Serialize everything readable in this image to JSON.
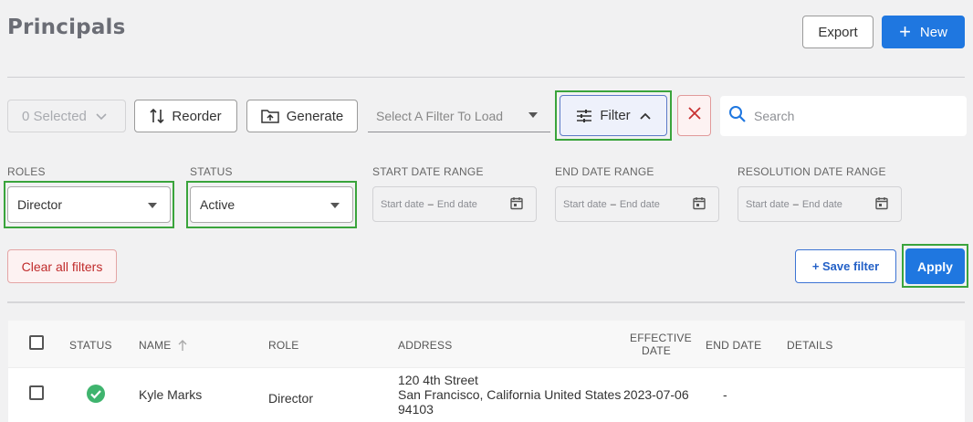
{
  "page": {
    "title": "Principals"
  },
  "header": {
    "export_label": "Export",
    "new_label": "New"
  },
  "toolbar": {
    "selected_label": "0 Selected",
    "reorder_label": "Reorder",
    "generate_label": "Generate",
    "filter_load_placeholder": "Select A Filter To Load",
    "filter_label": "Filter",
    "search_placeholder": "Search"
  },
  "filters": {
    "roles_label": "ROLES",
    "roles_value": "Director",
    "status_label": "STATUS",
    "status_value": "Active",
    "start_date_label": "START DATE RANGE",
    "end_date_label": "END DATE RANGE",
    "resolution_date_label": "RESOLUTION DATE RANGE",
    "start_placeholder": "Start date",
    "end_placeholder": "End date",
    "separator": "–"
  },
  "actions": {
    "clear_all_label": "Clear all filters",
    "save_filter_label": "+ Save filter",
    "apply_label": "Apply"
  },
  "table": {
    "headers": {
      "status": "STATUS",
      "name": "NAME",
      "role": "ROLE",
      "address": "ADDRESS",
      "effective_date_1": "EFFECTIVE",
      "effective_date_2": "DATE",
      "end_date": "END DATE",
      "details": "DETAILS"
    },
    "rows": [
      {
        "name": "Kyle Marks",
        "role": "Director",
        "address_1": "120 4th Street",
        "address_2": "San Francisco, California United States",
        "address_3": "94103",
        "effective_date": "2023-07-06",
        "end_date": "-"
      }
    ]
  },
  "colors": {
    "primary": "#1f77e0",
    "highlight": "#3aa43c",
    "danger": "#c02b2b",
    "success": "#3fb46e"
  }
}
